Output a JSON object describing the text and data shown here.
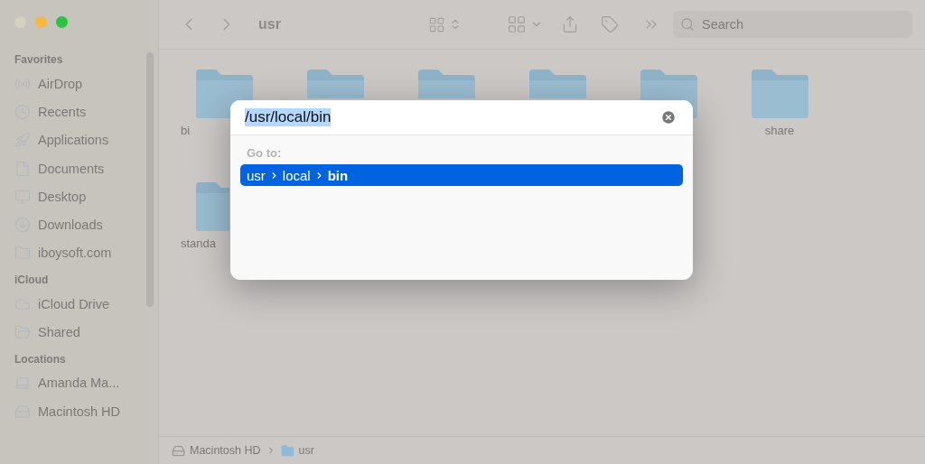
{
  "sidebar": {
    "sections": [
      {
        "title": "Favorites",
        "items": [
          {
            "label": "AirDrop"
          },
          {
            "label": "Recents"
          },
          {
            "label": "Applications"
          },
          {
            "label": "Documents"
          },
          {
            "label": "Desktop"
          },
          {
            "label": "Downloads"
          },
          {
            "label": "iboysoft.com"
          }
        ]
      },
      {
        "title": "iCloud",
        "items": [
          {
            "label": "iCloud Drive"
          },
          {
            "label": "Shared"
          }
        ]
      },
      {
        "title": "Locations",
        "items": [
          {
            "label": "Amanda Ma..."
          },
          {
            "label": "Macintosh HD"
          }
        ]
      }
    ]
  },
  "toolbar": {
    "title": "usr",
    "search": {
      "placeholder": "Search"
    }
  },
  "folders": [
    {
      "kind": "full",
      "label": "bi",
      "clipped": true
    },
    {
      "kind": "top_only"
    },
    {
      "kind": "top_only"
    },
    {
      "kind": "top_only"
    },
    {
      "kind": "full"
    },
    {
      "kind": "full",
      "label": "share",
      "clipped": false
    },
    {
      "kind": "left_only",
      "label": "standa",
      "clipped": true
    }
  ],
  "path_bar": [
    {
      "label": "Macintosh HD",
      "kind": "disk"
    },
    {
      "label": "usr",
      "kind": "folder"
    }
  ],
  "dialog": {
    "value": "/usr/local/bin",
    "text_selected": true,
    "heading": "Go to:",
    "results": [
      {
        "path": [
          "usr",
          "local",
          "bin"
        ],
        "selected": true
      }
    ]
  }
}
